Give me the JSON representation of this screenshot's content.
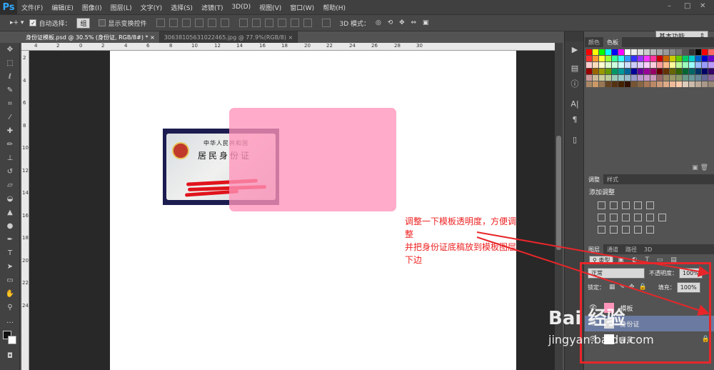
{
  "app": {
    "logo": "Ps"
  },
  "menu": [
    "文件(F)",
    "编辑(E)",
    "图像(I)",
    "图层(L)",
    "文字(Y)",
    "选择(S)",
    "滤镜(T)",
    "3D(D)",
    "视图(V)",
    "窗口(W)",
    "帮助(H)"
  ],
  "options": {
    "auto_select": "自动选择：",
    "group_value": "组",
    "show_transform": "显示变换控件",
    "mode3d": "3D 模式：",
    "workspace": "基本功能"
  },
  "tabs": [
    {
      "label": "身份证模板.psd @ 30.5% (身份证, RGB/8#) *",
      "close": "×"
    },
    {
      "label": "30638105631022465.jpg @ 77.9%(RGB/8)",
      "close": "×"
    }
  ],
  "ruler": {
    "h": [
      "4",
      "2",
      "0",
      "2",
      "4",
      "6",
      "8",
      "10",
      "12",
      "14",
      "16",
      "18",
      "20",
      "22",
      "24",
      "26",
      "28",
      "30"
    ],
    "v": [
      "2",
      "4",
      "6",
      "8",
      "10",
      "12",
      "14",
      "16",
      "18",
      "20",
      "22",
      "24"
    ]
  },
  "idcard": {
    "line1": "中华人民共和国",
    "line2": "居民身份证"
  },
  "annotation": [
    "调整一下模板透明度，方便调整",
    "并把身份证底稿放到模板图层下边"
  ],
  "panels": {
    "swatches_tabs": [
      "颜色",
      "色板"
    ],
    "adjust_tabs": [
      "调整",
      "样式"
    ],
    "adjust_title": "添加调整",
    "layers_tabs": [
      "图层",
      "通道",
      "路径",
      "3D"
    ],
    "kind": "类型",
    "blend": "正常",
    "opacity_label": "不透明度：",
    "opacity": "100%",
    "lock_label": "锁定：",
    "fill_label": "填充：",
    "fill": "100%",
    "layers": [
      "模板",
      "身份证",
      "背景"
    ]
  },
  "watermark": {
    "brand": "Bai 经验",
    "url": "jingyan.baidu.com"
  },
  "colors": {
    "pink": "#ff94ba",
    "annotation": "#e22222",
    "highlight": "#e8262a"
  }
}
